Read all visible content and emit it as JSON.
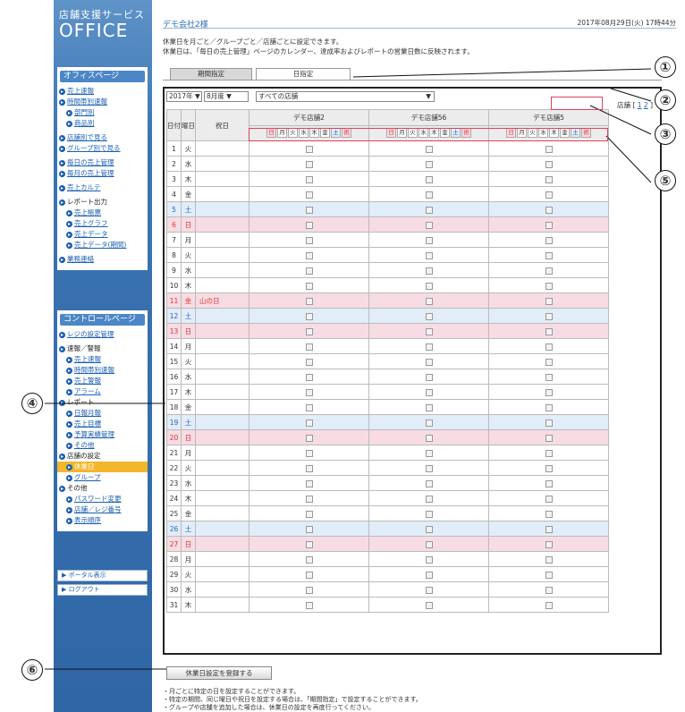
{
  "brand": {
    "small": "店舗支援サービス",
    "big": "OFFICE"
  },
  "sidebar": {
    "header1": "オフィスページ",
    "items1": [
      "売上速報",
      "時間帯別速報",
      "部門別",
      "商品別",
      "店舗別で見る",
      "グループ別で見る",
      "毎日の売上管理",
      "毎月の売上管理",
      "売上カルテ",
      "レポート出力",
      "売上帳票",
      "売上グラフ",
      "売上データ",
      "売上データ(期間)",
      "業務連絡"
    ],
    "header2": "コントロールページ",
    "items2": [
      "レジの設定管理",
      "速報／警報",
      "売上速報",
      "時間帯別速報",
      "売上警報",
      "アラーム",
      "レポート",
      "日報月報",
      "売上目標",
      "予算実績管理",
      "その他",
      "店舗の設定",
      "休業日",
      "グループ",
      "その他",
      "パスワード変更",
      "店舗／レジ番号",
      "表示順序"
    ],
    "portal": "ポータル表示",
    "logout": "ログアウト"
  },
  "header": {
    "company": "デモ会社2様",
    "datetime": "2017年08月29日(火) 17時44分",
    "desc1": "休業日を月ごと／グループごと／店舗ごとに設定できます。",
    "desc2": "休業日は、「毎日の売上管理」ページのカレンダー、達成率およびレポートの営業日数に反映されます。"
  },
  "tabs": [
    "期間指定",
    "日指定"
  ],
  "controls": {
    "year": "2017年",
    "month": "8月度",
    "scope": "すべての店舗",
    "store_label": "店舗",
    "pages": [
      "1",
      "2"
    ]
  },
  "table": {
    "col_day": "日付",
    "col_wd": "曜日",
    "col_hol": "祝日",
    "stores": [
      "デモ店舗2",
      "デモ店舗56",
      "デモ店舗5"
    ],
    "weekdays": [
      "日",
      "月",
      "火",
      "水",
      "木",
      "金",
      "土",
      "祝"
    ],
    "rows": [
      {
        "d": "1",
        "w": "火",
        "h": "",
        "t": ""
      },
      {
        "d": "2",
        "w": "水",
        "h": "",
        "t": ""
      },
      {
        "d": "3",
        "w": "木",
        "h": "",
        "t": ""
      },
      {
        "d": "4",
        "w": "金",
        "h": "",
        "t": ""
      },
      {
        "d": "5",
        "w": "土",
        "h": "",
        "t": "sat"
      },
      {
        "d": "6",
        "w": "日",
        "h": "",
        "t": "sun"
      },
      {
        "d": "7",
        "w": "月",
        "h": "",
        "t": ""
      },
      {
        "d": "8",
        "w": "火",
        "h": "",
        "t": ""
      },
      {
        "d": "9",
        "w": "水",
        "h": "",
        "t": ""
      },
      {
        "d": "10",
        "w": "木",
        "h": "",
        "t": ""
      },
      {
        "d": "11",
        "w": "金",
        "h": "山の日",
        "t": "sun"
      },
      {
        "d": "12",
        "w": "土",
        "h": "",
        "t": "sat"
      },
      {
        "d": "13",
        "w": "日",
        "h": "",
        "t": "sun"
      },
      {
        "d": "14",
        "w": "月",
        "h": "",
        "t": ""
      },
      {
        "d": "15",
        "w": "火",
        "h": "",
        "t": ""
      },
      {
        "d": "16",
        "w": "水",
        "h": "",
        "t": ""
      },
      {
        "d": "17",
        "w": "木",
        "h": "",
        "t": ""
      },
      {
        "d": "18",
        "w": "金",
        "h": "",
        "t": ""
      },
      {
        "d": "19",
        "w": "土",
        "h": "",
        "t": "sat"
      },
      {
        "d": "20",
        "w": "日",
        "h": "",
        "t": "sun"
      },
      {
        "d": "21",
        "w": "月",
        "h": "",
        "t": ""
      },
      {
        "d": "22",
        "w": "火",
        "h": "",
        "t": ""
      },
      {
        "d": "23",
        "w": "水",
        "h": "",
        "t": ""
      },
      {
        "d": "24",
        "w": "木",
        "h": "",
        "t": ""
      },
      {
        "d": "25",
        "w": "金",
        "h": "",
        "t": ""
      },
      {
        "d": "26",
        "w": "土",
        "h": "",
        "t": "sat"
      },
      {
        "d": "27",
        "w": "日",
        "h": "",
        "t": "sun"
      },
      {
        "d": "28",
        "w": "月",
        "h": "",
        "t": ""
      },
      {
        "d": "29",
        "w": "火",
        "h": "",
        "t": ""
      },
      {
        "d": "30",
        "w": "水",
        "h": "",
        "t": ""
      },
      {
        "d": "31",
        "w": "木",
        "h": "",
        "t": ""
      }
    ]
  },
  "register_button": "休業日設定を登録する",
  "notes": [
    "・月ごとに特定の日を設定することができます。",
    "・特定の期間、同じ曜日や祝日を設定する場合は、「期間指定」で設定することができます。",
    "・グループや店舗を追加した場合は、休業日の設定を再度行ってください。"
  ],
  "callouts": [
    "①",
    "②",
    "③",
    "④",
    "⑤",
    "⑥"
  ]
}
